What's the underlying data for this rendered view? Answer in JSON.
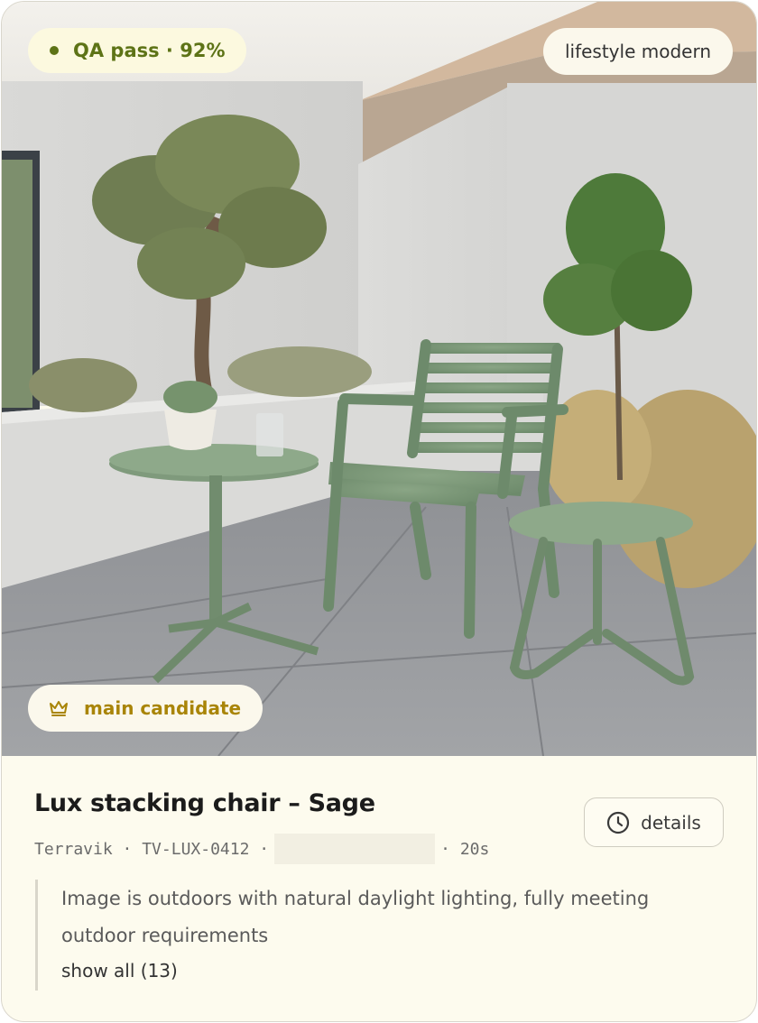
{
  "badges": {
    "qa": "QA pass · 92%",
    "style": "lifestyle modern",
    "main": "main candidate"
  },
  "icons": {
    "qa_dot": "status-dot-icon",
    "crown": "crown-icon",
    "clock": "clock-icon"
  },
  "product": {
    "title": "Lux stacking chair – Sage",
    "brand": "Terravik",
    "sku": "TV-LUX-0412",
    "duration": "20s"
  },
  "details_button": "details",
  "note": {
    "text": "Image is outdoors with natural daylight lighting, fully meeting outdoor requirements",
    "show_all": "show all (13)"
  },
  "colors": {
    "qa_accent": "#5d7316",
    "candidate_accent": "#a98508",
    "card_bg": "#fdfbee",
    "furniture": "#7f9a7c"
  }
}
